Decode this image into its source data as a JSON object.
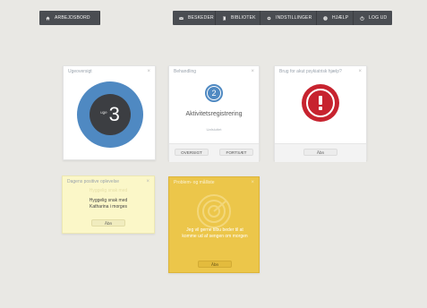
{
  "header": {
    "home_label": "Arbejdsbord",
    "nav": [
      {
        "label": "Beskeder",
        "icon": "mail-icon"
      },
      {
        "label": "Bibliotek",
        "icon": "book-icon"
      },
      {
        "label": "Indstillinger",
        "icon": "gear-icon"
      },
      {
        "label": "Hjælp",
        "icon": "help-icon"
      },
      {
        "label": "Log ud",
        "icon": "logout-icon"
      }
    ]
  },
  "cards": {
    "overview": {
      "title": "Ugeoversigt",
      "week_label": "uge",
      "week_number": "3",
      "ring_color": "#4f89c2",
      "center_color": "#3c3e42"
    },
    "treatment": {
      "title": "Behandling",
      "step_number": "2",
      "step_title": "Aktivitetsregistrering",
      "step_status": "Uafsluttet",
      "overview_btn": "Oversigt",
      "continue_btn": "Fortsæt",
      "accent_color": "#4f89c2"
    },
    "help": {
      "title": "Brug for akut psykiatrisk hjælp?",
      "open_btn": "Åbn",
      "alert_color": "#c7232f"
    },
    "positive": {
      "title": "Dagens positive oplevelse",
      "faded_text": "Hyggelig snak med",
      "line1": "Hyggelig snak med",
      "line2": "Katharina i morges",
      "open_btn": "Åbn",
      "bg_color": "#fbf7c8"
    },
    "problems": {
      "title": "Problem- og målliste",
      "body": "Jeg vil gerne tilbu beder til at komme ud af sengen om morgen",
      "open_btn": "Åbn",
      "bg_color": "#ecc64a"
    }
  }
}
